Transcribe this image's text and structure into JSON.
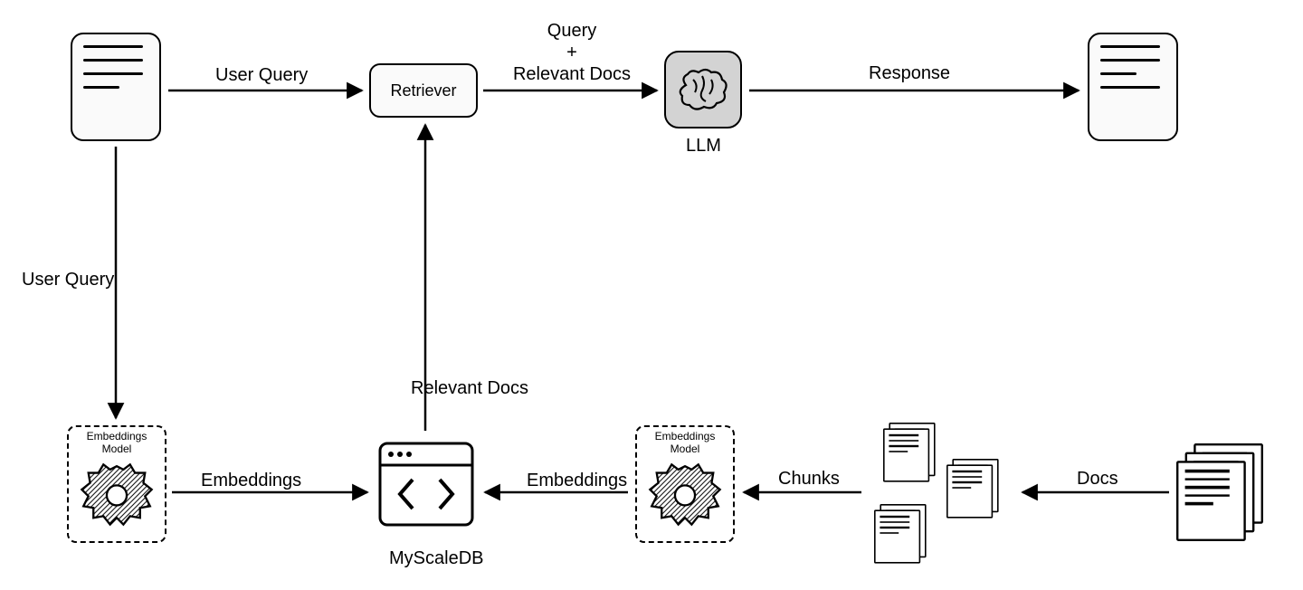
{
  "nodes": {
    "user_query_doc": "User Query",
    "retriever": "Retriever",
    "llm": "LLM",
    "response_doc": "Response",
    "embed_left_title": "Embeddings\nModel",
    "embed_right_title": "Embeddings\nModel",
    "db_label": "MyScaleDB"
  },
  "edges": {
    "userquery_to_retriever": "User Query",
    "retriever_to_llm": "Query\n+\nRelevant Docs",
    "llm_to_response": "Response",
    "userdoc_to_embed": "User Query",
    "embedleft_to_db": "Embeddings",
    "db_to_retriever": "Relevant Docs",
    "embedright_to_db": "Embeddings",
    "chunks_to_embedright": "Chunks",
    "docs_to_chunks": "Docs"
  }
}
